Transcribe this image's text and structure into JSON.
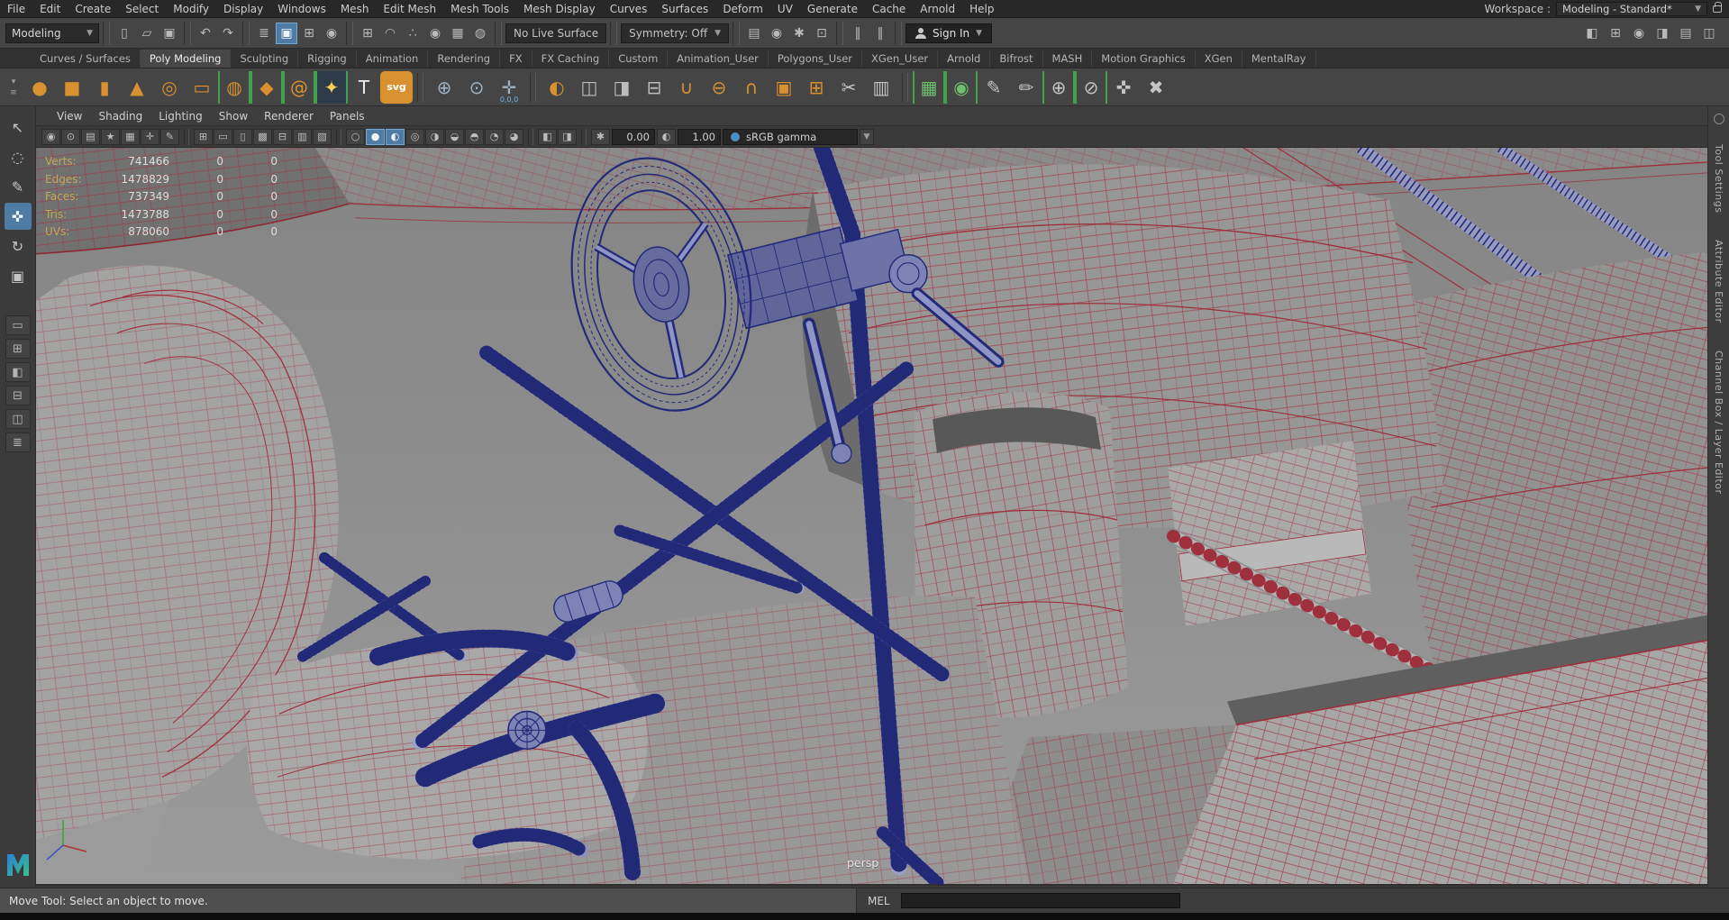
{
  "menubar": {
    "items": [
      "File",
      "Edit",
      "Create",
      "Select",
      "Modify",
      "Display",
      "Windows",
      "Mesh",
      "Edit Mesh",
      "Mesh Tools",
      "Mesh Display",
      "Curves",
      "Surfaces",
      "Deform",
      "UV",
      "Generate",
      "Cache",
      "Arnold",
      "Help"
    ],
    "workspace_label": "Workspace :",
    "workspace_value": "Modeling - Standard*"
  },
  "statusline": {
    "menuset": "Modeling",
    "file_group": [
      {
        "name": "new-scene-icon",
        "glyph": "▯"
      },
      {
        "name": "open-scene-icon",
        "glyph": "▱"
      },
      {
        "name": "save-scene-icon",
        "glyph": "▣"
      }
    ],
    "history_group": [
      {
        "name": "undo-icon",
        "glyph": "↶"
      },
      {
        "name": "redo-icon",
        "glyph": "↷"
      }
    ],
    "selection_group": [
      {
        "name": "select-hierarchy-icon",
        "glyph": "≣",
        "active": false
      },
      {
        "name": "select-object-icon",
        "glyph": "▣",
        "active": true
      },
      {
        "name": "select-component-icon",
        "glyph": "⊞",
        "active": false
      },
      {
        "name": "select-asset-icon",
        "glyph": "◉",
        "active": false
      }
    ],
    "snap_group": [
      {
        "name": "snap-grid-icon",
        "glyph": "⊞"
      },
      {
        "name": "snap-curve-icon",
        "glyph": "◠"
      },
      {
        "name": "snap-point-icon",
        "glyph": "∴"
      },
      {
        "name": "snap-projected-center-icon",
        "glyph": "◉"
      },
      {
        "name": "snap-view-plane-icon",
        "glyph": "▦"
      },
      {
        "name": "make-live-icon",
        "glyph": "◍"
      }
    ],
    "live_surface": "No Live Surface",
    "symmetry": "Symmetry: Off",
    "render_group": [
      {
        "name": "render-view-icon",
        "glyph": "▤"
      },
      {
        "name": "render-current-frame-icon",
        "glyph": "◉"
      },
      {
        "name": "ipr-render-icon",
        "glyph": "✱"
      },
      {
        "name": "render-settings-icon",
        "glyph": "⊡"
      }
    ],
    "playback_group": [
      {
        "name": "pause-icon",
        "glyph": "‖"
      },
      {
        "name": "step-pause-icon",
        "glyph": "‖"
      }
    ],
    "sign_in_label": "Sign In",
    "right_group": [
      {
        "name": "workspace-panel-icon",
        "glyph": "◧"
      },
      {
        "name": "modeling-toolkit-toggle-icon",
        "glyph": "⊞"
      },
      {
        "name": "character-controls-toggle-icon",
        "glyph": "◉"
      },
      {
        "name": "attribute-editor-toggle-icon",
        "glyph": "◨"
      },
      {
        "name": "tool-settings-toggle-icon",
        "glyph": "▤"
      },
      {
        "name": "channel-box-toggle-icon",
        "glyph": "◫"
      }
    ]
  },
  "shelf": {
    "lead": [
      {
        "name": "shelf-tab-menu-icon",
        "glyph": "▾"
      },
      {
        "name": "shelf-menu-icon",
        "glyph": "≡"
      }
    ],
    "tabs": [
      {
        "label": "Curves / Surfaces",
        "active": false
      },
      {
        "label": "Poly Modeling",
        "active": true
      },
      {
        "label": "Sculpting",
        "active": false
      },
      {
        "label": "Rigging",
        "active": false
      },
      {
        "label": "Animation",
        "active": false
      },
      {
        "label": "Rendering",
        "active": false
      },
      {
        "label": "FX",
        "active": false
      },
      {
        "label": "FX Caching",
        "active": false
      },
      {
        "label": "Custom",
        "active": false
      },
      {
        "label": "Animation_User",
        "active": false
      },
      {
        "label": "Polygons_User",
        "active": false
      },
      {
        "label": "XGen_User",
        "active": false
      },
      {
        "label": "Arnold",
        "active": false
      },
      {
        "label": "Bifrost",
        "active": false
      },
      {
        "label": "MASH",
        "active": false
      },
      {
        "label": "Motion Graphics",
        "active": false
      },
      {
        "label": "XGen",
        "active": false
      },
      {
        "label": "MentalRay",
        "active": false
      }
    ],
    "g1": [
      {
        "name": "poly-sphere-icon",
        "glyph": "●",
        "fg": "#d9912f"
      },
      {
        "name": "poly-cube-icon",
        "glyph": "■",
        "fg": "#d9912f"
      },
      {
        "name": "poly-cylinder-icon",
        "glyph": "▮",
        "fg": "#d9912f"
      },
      {
        "name": "poly-cone-icon",
        "glyph": "▲",
        "fg": "#d9912f"
      },
      {
        "name": "poly-torus-icon",
        "glyph": "◎",
        "fg": "#d9912f"
      },
      {
        "name": "poly-plane-icon",
        "glyph": "▭",
        "fg": "#d9912f"
      },
      {
        "name": "poly-disc-icon",
        "glyph": "◍",
        "fg": "#d9912f",
        "bracket": true
      },
      {
        "name": "platonic-solid-icon",
        "glyph": "◆",
        "fg": "#d9912f",
        "bracket": true
      },
      {
        "name": "sweep-mesh-icon",
        "glyph": "@",
        "fg": "#d9912f",
        "bracket": true
      },
      {
        "name": "poly-type-sparkle-icon",
        "glyph": "✦",
        "fg": "#ffd04d",
        "bg": "#2c3a4a",
        "bracket": true
      },
      {
        "name": "type-tool-icon",
        "glyph": "T",
        "fg": "#ececec"
      },
      {
        "name": "svg-tool-icon",
        "glyph": "svg",
        "fg": "#ffffff",
        "bg": "#d9912f",
        "small": true
      }
    ],
    "g2": [
      {
        "name": "construction-plane-icon",
        "glyph": "⊕",
        "fg": "#9db4c6"
      },
      {
        "name": "locator-icon",
        "glyph": "⊙",
        "fg": "#9db4c6"
      },
      {
        "name": "origin-locator-icon",
        "glyph": "✛",
        "fg": "#9db4c6",
        "sub": "0,0,0"
      }
    ],
    "g3": [
      {
        "name": "mirror-icon",
        "glyph": "◐",
        "fg": "#d9912f"
      },
      {
        "name": "combine-icon",
        "glyph": "◫",
        "fg": "#bdbdbd"
      },
      {
        "name": "separate-icon",
        "glyph": "◨",
        "fg": "#bdbdbd"
      },
      {
        "name": "extract-icon",
        "glyph": "⊟",
        "fg": "#bdbdbd"
      },
      {
        "name": "boolean-union-icon",
        "glyph": "∪",
        "fg": "#d9912f"
      },
      {
        "name": "boolean-difference-icon",
        "glyph": "⊖",
        "fg": "#d9912f"
      },
      {
        "name": "boolean-intersection-icon",
        "glyph": "∩",
        "fg": "#d9912f"
      },
      {
        "name": "smooth-mesh-icon",
        "glyph": "▣",
        "fg": "#d9912f"
      },
      {
        "name": "poke-face-icon",
        "glyph": "⊞",
        "fg": "#d9912f"
      },
      {
        "name": "multi-cut-icon",
        "glyph": "✂",
        "fg": "#c4c4c4"
      },
      {
        "name": "insert-edge-loop-icon",
        "glyph": "▥",
        "fg": "#c4c4c4"
      }
    ],
    "g4": [
      {
        "name": "quad-draw-icon",
        "glyph": "▦",
        "fg": "#6cc06c",
        "bracket": true
      },
      {
        "name": "multi-component-icon",
        "glyph": "◉",
        "fg": "#6cc06c",
        "bracket": true
      },
      {
        "name": "sculpt-pencil-icon",
        "glyph": "✎",
        "fg": "#c4c4c4"
      },
      {
        "name": "grease-marker-icon",
        "glyph": "✏",
        "fg": "#c4c4c4"
      },
      {
        "name": "target-weld-icon",
        "glyph": "⊕",
        "fg": "#c4c4c4",
        "bracket": true
      },
      {
        "name": "slide-edge-icon",
        "glyph": "⊘",
        "fg": "#c4c4c4",
        "bracket": true
      },
      {
        "name": "transform-constraint-icon",
        "glyph": "✜",
        "fg": "#c4c4c4"
      },
      {
        "name": "knife-cut-icon",
        "glyph": "✖",
        "fg": "#c4c4c4"
      }
    ]
  },
  "toolbox": {
    "tools": [
      {
        "name": "select-tool-icon",
        "glyph": "↖",
        "active": false
      },
      {
        "name": "lasso-tool-icon",
        "glyph": "◌",
        "active": false
      },
      {
        "name": "paint-select-tool-icon",
        "glyph": "✎",
        "active": false
      },
      {
        "name": "move-tool-icon",
        "glyph": "✜",
        "active": true
      },
      {
        "name": "rotate-tool-icon",
        "glyph": "↻",
        "active": false
      },
      {
        "name": "scale-tool-icon",
        "glyph": "▣",
        "active": false
      }
    ],
    "layouts": [
      {
        "name": "single-pane-layout-icon",
        "glyph": "▭"
      },
      {
        "name": "four-pane-layout-icon",
        "glyph": "⊞"
      },
      {
        "name": "persp-outliner-layout-icon",
        "glyph": "◧"
      },
      {
        "name": "persp-graph-layout-icon",
        "glyph": "⊟"
      },
      {
        "name": "hypershade-layout-icon",
        "glyph": "◫"
      },
      {
        "name": "outliner-panel-icon",
        "glyph": "≣"
      }
    ]
  },
  "panel": {
    "menus": [
      "View",
      "Shading",
      "Lighting",
      "Show",
      "Renderer",
      "Panels"
    ],
    "tb1": [
      {
        "name": "select-camera-icon",
        "glyph": "◉"
      },
      {
        "name": "lock-camera-icon",
        "glyph": "⊙"
      },
      {
        "name": "camera-attributes-icon",
        "glyph": "▤"
      },
      {
        "name": "bookmark-icon",
        "glyph": "★"
      },
      {
        "name": "image-plane-icon",
        "glyph": "▦"
      },
      {
        "name": "pan-zoom-icon",
        "glyph": "✛"
      },
      {
        "name": "grease-pencil-icon",
        "glyph": "✎"
      }
    ],
    "tb2": [
      {
        "name": "grid-toggle-icon",
        "glyph": "⊞"
      },
      {
        "name": "film-gate-icon",
        "glyph": "▭"
      },
      {
        "name": "resolution-gate-icon",
        "glyph": "▯"
      },
      {
        "name": "gate-mask-icon",
        "glyph": "▩"
      },
      {
        "name": "field-chart-icon",
        "glyph": "⊟"
      },
      {
        "name": "safe-action-icon",
        "glyph": "▥"
      },
      {
        "name": "safe-title-icon",
        "glyph": "▧"
      }
    ],
    "tb3": [
      {
        "name": "wireframe-mode-icon",
        "glyph": "○",
        "active": false
      },
      {
        "name": "shaded-mode-icon",
        "glyph": "●",
        "active": true
      },
      {
        "name": "textured-mode-icon",
        "glyph": "◐",
        "active": true
      },
      {
        "name": "all-lights-icon",
        "glyph": "◎",
        "active": false
      },
      {
        "name": "shadows-icon",
        "glyph": "◑",
        "active": false
      },
      {
        "name": "ao-icon",
        "glyph": "◒",
        "active": false
      },
      {
        "name": "motion-blur-icon",
        "glyph": "◓",
        "active": false
      },
      {
        "name": "multisample-icon",
        "glyph": "◔",
        "active": false
      },
      {
        "name": "dof-icon",
        "glyph": "◕",
        "active": false
      }
    ],
    "tb4": [
      {
        "name": "isolate-select-icon",
        "glyph": "◧"
      },
      {
        "name": "xray-icon",
        "glyph": "◨"
      }
    ],
    "exposure_icon_glyph": "✱",
    "exposure": "0.00",
    "gamma_icon_glyph": "◐",
    "gamma": "1.00",
    "view_transform": "sRGB gamma"
  },
  "hud": {
    "rows": [
      {
        "label": "Verts:",
        "v1": "741466",
        "v2": "0",
        "v3": "0"
      },
      {
        "label": "Edges:",
        "v1": "1478829",
        "v2": "0",
        "v3": "0"
      },
      {
        "label": "Faces:",
        "v1": "737349",
        "v2": "0",
        "v3": "0"
      },
      {
        "label": "Tris:",
        "v1": "1473788",
        "v2": "0",
        "v3": "0"
      },
      {
        "label": "UVs:",
        "v1": "878060",
        "v2": "0",
        "v3": "0"
      }
    ]
  },
  "viewport": {
    "camera_label": "persp"
  },
  "sidebar_right": {
    "tabs": [
      "Tool Settings",
      "Attribute Editor",
      "Channel Box / Layer Editor"
    ]
  },
  "bottom": {
    "help_text": "Move Tool: Select an object to move.",
    "command_label": "MEL",
    "command_value": ""
  }
}
